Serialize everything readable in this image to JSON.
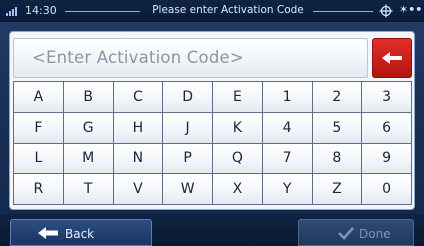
{
  "status_bar": {
    "time": "14:30",
    "title": "Please enter Activation Code",
    "icons": [
      "signal-icon",
      "gps-icon",
      "satellite-icon"
    ]
  },
  "input": {
    "placeholder": "<Enter Activation Code>",
    "value": ""
  },
  "backspace": {
    "icon": "backspace-arrow-icon",
    "color": "#d0201a"
  },
  "keys": [
    [
      "A",
      "B",
      "C",
      "D",
      "E",
      "1",
      "2",
      "3"
    ],
    [
      "F",
      "G",
      "H",
      "J",
      "K",
      "4",
      "5",
      "6"
    ],
    [
      "L",
      "M",
      "N",
      "P",
      "Q",
      "7",
      "8",
      "9"
    ],
    [
      "R",
      "T",
      "V",
      "W",
      "X",
      "Y",
      "Z",
      "0"
    ]
  ],
  "bottom": {
    "back_label": "Back",
    "back_icon": "left-arrow-icon",
    "done_label": "Done",
    "done_icon": "checkmark-icon",
    "done_enabled": false
  }
}
